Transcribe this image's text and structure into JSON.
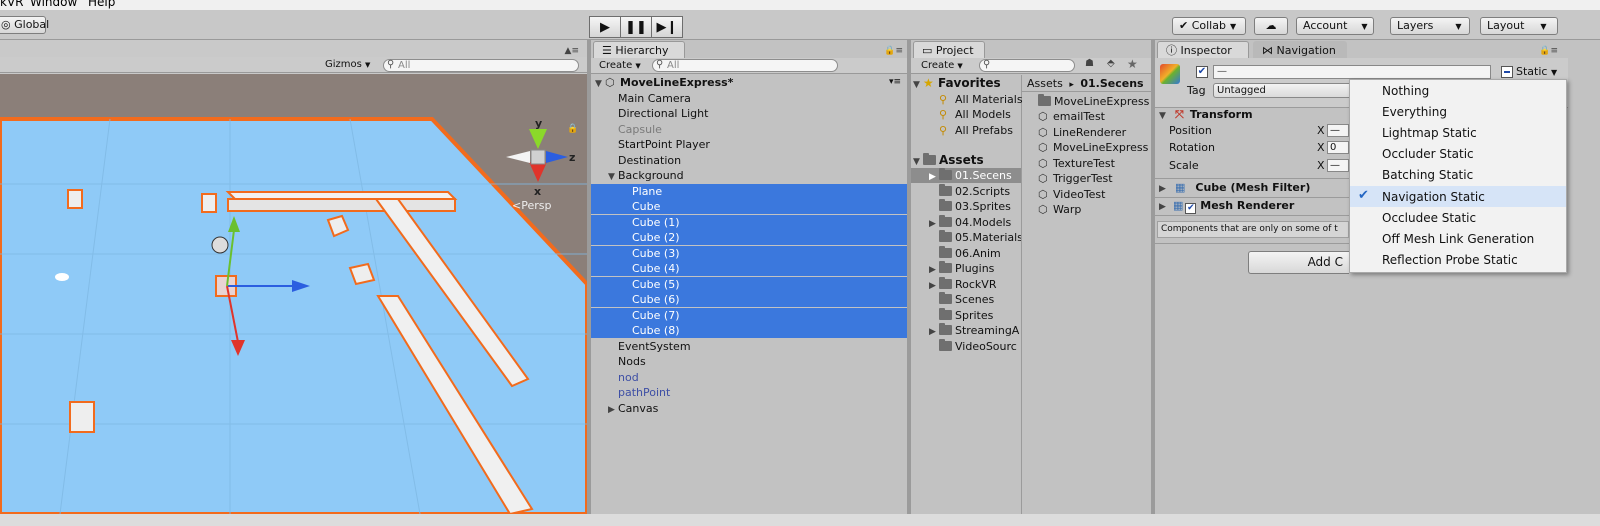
{
  "menubar": {
    "items": [
      "kVR",
      "Window",
      "Help"
    ]
  },
  "toolbar": {
    "global_label": "Global",
    "collab_label": "Collab",
    "account_label": "Account",
    "layers_label": "Layers",
    "layout_label": "Layout"
  },
  "scene": {
    "gizmos_label": "Gizmos",
    "search_placeholder": "All",
    "persp_label": "Persp",
    "axis_y": "y",
    "axis_x": "x",
    "axis_z": "z"
  },
  "hierarchy": {
    "tab_label": "Hierarchy",
    "create_label": "Create",
    "search_placeholder": "All",
    "scene_name": "MoveLineExpress*",
    "items": [
      "Main Camera",
      "Directional Light",
      "Capsule",
      "StartPoint Player",
      "Destination",
      "Background",
      "Plane",
      "Cube",
      "Cube (1)",
      "Cube (2)",
      "Cube (3)",
      "Cube (4)",
      "Cube (5)",
      "Cube (6)",
      "Cube (7)",
      "Cube (8)",
      "EventSystem",
      "Nods",
      "nod",
      "pathPoint",
      "Canvas"
    ]
  },
  "project": {
    "tab_label": "Project",
    "create_label": "Create",
    "favorites_label": "Favorites",
    "favorites": [
      "All Materials",
      "All Models",
      "All Prefabs"
    ],
    "assets_label": "Assets",
    "folders": [
      "01.Secens",
      "02.Scripts",
      "03.Sprites",
      "04.Models",
      "05.Materials",
      "06.Anim",
      "Plugins",
      "RockVR",
      "Scenes",
      "Sprites",
      "StreamingA",
      "VideoSourc"
    ],
    "breadcrumb_root": "Assets",
    "breadcrumb_sep": "▸",
    "breadcrumb_current": "01.Secens",
    "files": [
      "MoveLineExpress",
      "emailTest",
      "LineRenderer",
      "MoveLineExpress",
      "TextureTest",
      "TriggerTest",
      "VideoTest",
      "Warp"
    ]
  },
  "inspector": {
    "tab_label": "Inspector",
    "nav_tab_label": "Navigation",
    "name_value": "—",
    "static_label": "Static",
    "tag_label": "Tag",
    "tag_value": "Untagged",
    "transform_label": "Transform",
    "position_label": "Position",
    "rotation_label": "Rotation",
    "scale_label": "Scale",
    "axis_x": "X",
    "position_x": "—",
    "rotation_x": "0",
    "scale_x": "—",
    "mesh_filter_label": "Cube (Mesh Filter)",
    "mesh_renderer_label": "Mesh Renderer",
    "components_note": "Components that are only on some of t",
    "add_component_label": "Add C"
  },
  "static_menu": {
    "items": [
      "Nothing",
      "Everything",
      "Lightmap Static",
      "Occluder Static",
      "Batching Static",
      "Navigation Static",
      "Occludee Static",
      "Off Mesh Link Generation",
      "Reflection Probe Static"
    ],
    "checked": "Navigation Static"
  },
  "colors": {
    "selection": "#3b78dd",
    "scene_plane": "#8fcaf7",
    "outline": "#f26b1d"
  }
}
